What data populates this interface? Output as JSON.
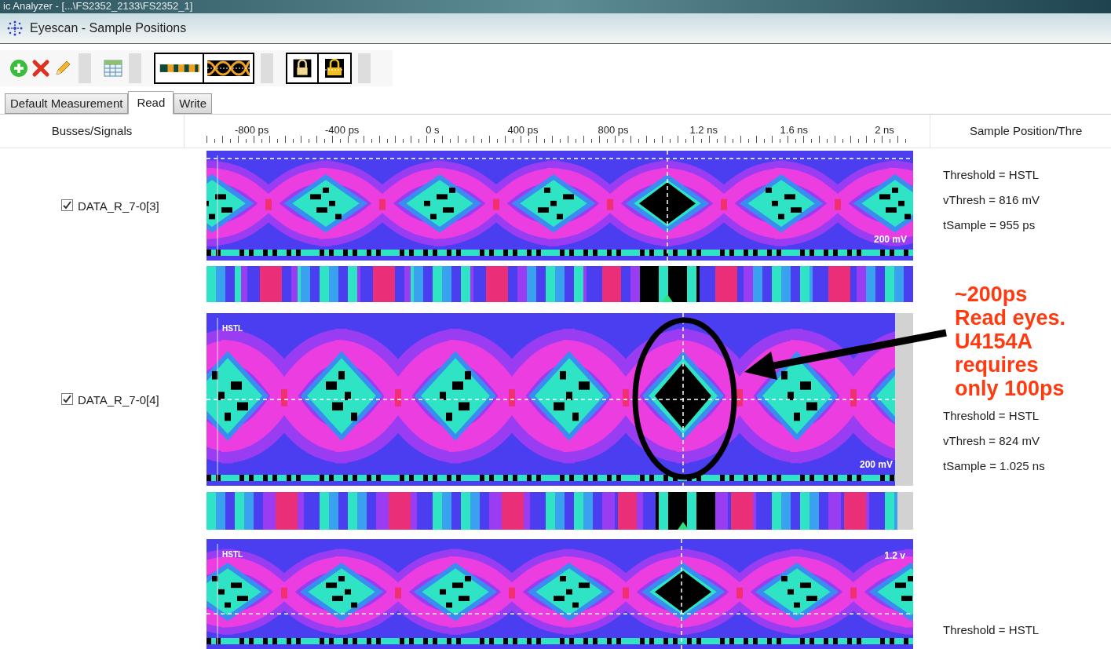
{
  "app_title": "ic Analyzer - [...\\FS2352_2133\\FS2352_1]",
  "window": {
    "title": "Eyescan - Sample Positions"
  },
  "tabs": [
    {
      "label": "Default Measurement",
      "selected": false
    },
    {
      "label": "Read",
      "selected": true
    },
    {
      "label": "Write",
      "selected": false
    }
  ],
  "columns": {
    "signals": "Busses/Signals",
    "position": "Sample Position/Thre"
  },
  "time_axis": [
    "-800 ps",
    "-400 ps",
    "0 s",
    "400 ps",
    "800 ps",
    "1.2 ns",
    "1.6 ns",
    "2 ns"
  ],
  "signals": [
    {
      "name": "DATA_R_7-0[3]",
      "checked": true,
      "eye_labels": {
        "bottom_right": "200 mV"
      },
      "info": [
        "Threshold = HSTL",
        "vThresh = 816 mV",
        "tSample = 955 ps"
      ]
    },
    {
      "name": "DATA_R_7-0[4]",
      "checked": true,
      "eye_labels": {
        "top_left": "HSTL",
        "bottom_right": "200 mV"
      },
      "info": [
        "Threshold = HSTL",
        "vThresh = 824 mV",
        "tSample = 1.025 ns"
      ]
    },
    {
      "eye_labels": {
        "top_left": "HSTL",
        "top_right": "1.2 v"
      },
      "info": [
        "Threshold = HSTL"
      ]
    }
  ],
  "annotation": {
    "lines": [
      "~200ps",
      "Read eyes.",
      "U4154A",
      "requires",
      "only 100ps"
    ]
  }
}
